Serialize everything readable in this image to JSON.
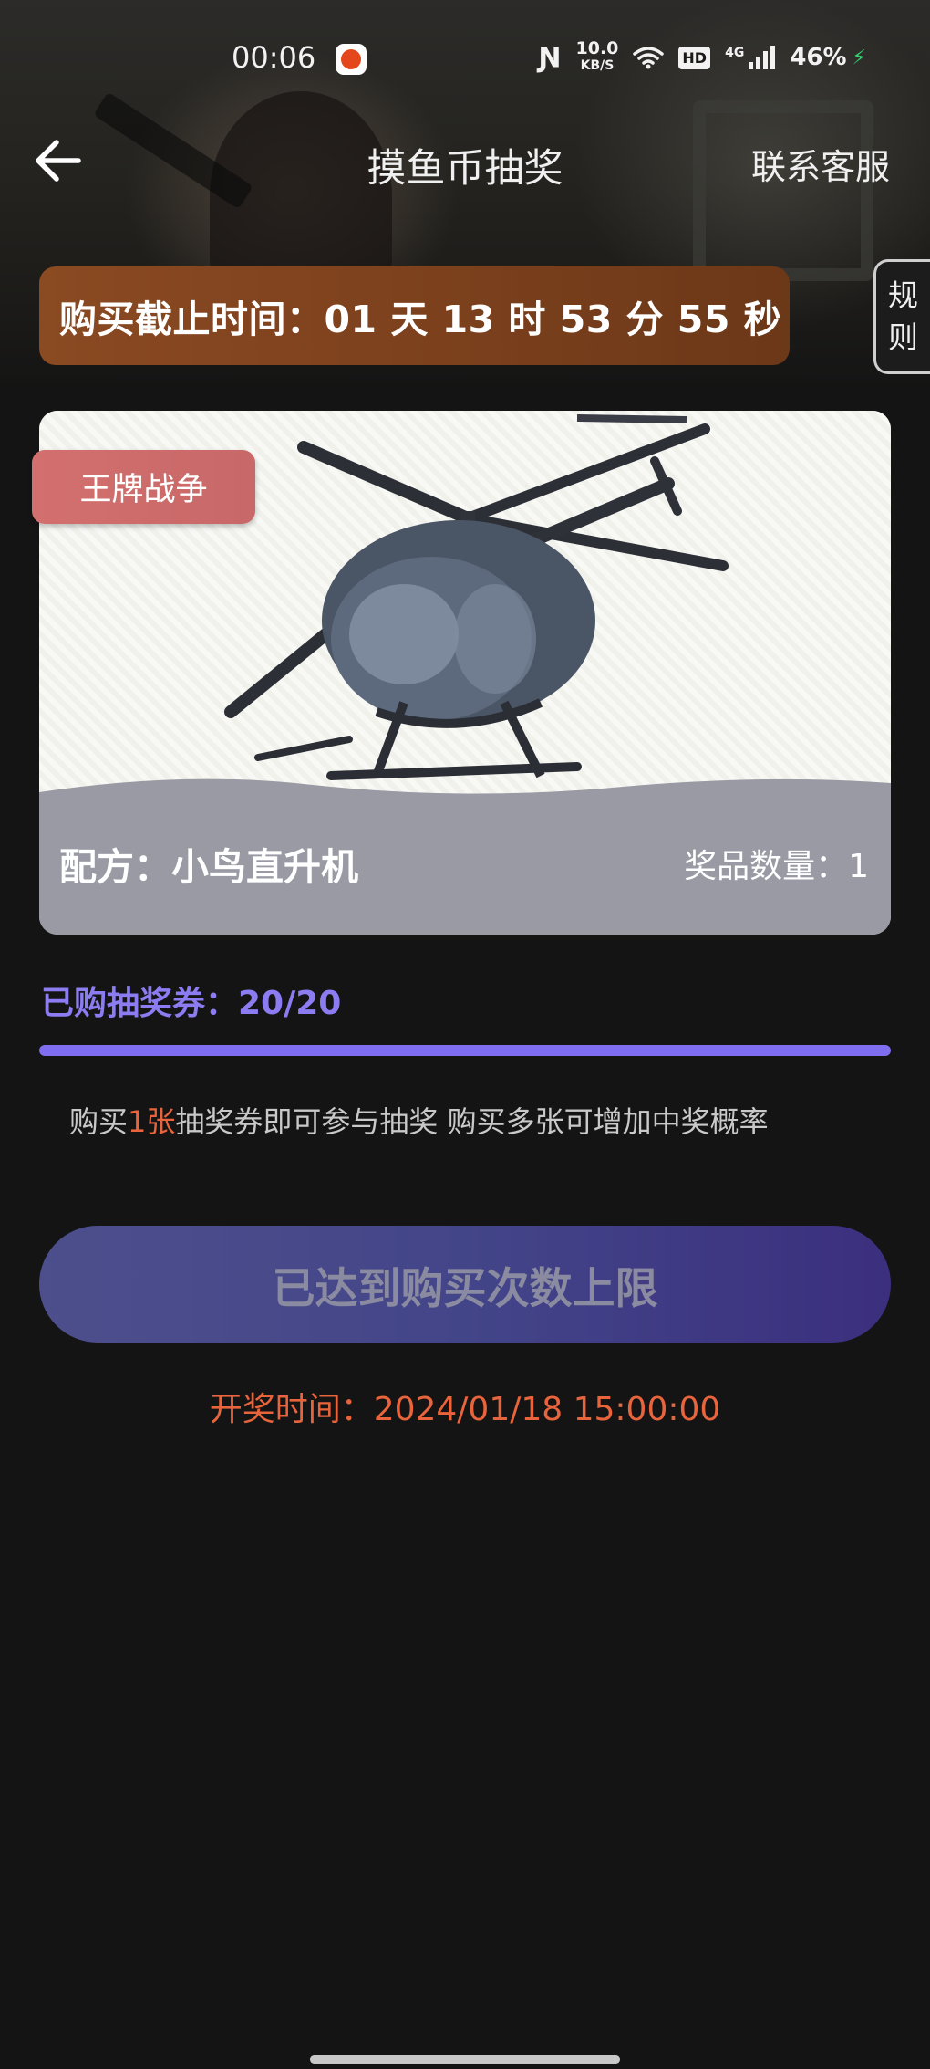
{
  "status_bar": {
    "time": "00:06",
    "net_speed_value": "10.0",
    "net_speed_unit": "KB/S",
    "hd_label": "HD",
    "network_type": "4G",
    "battery": "46%"
  },
  "nav": {
    "title": "摸鱼币抽奖",
    "contact_label": "联系客服"
  },
  "rules_tab": {
    "line1": "规",
    "line2": "则"
  },
  "countdown": {
    "text": "购买截止时间：01 天 13 时 53 分 55 秒"
  },
  "prize": {
    "game_tag": "王牌战争",
    "name": "配方：小鸟直升机",
    "quantity": "奖品数量：1"
  },
  "tickets": {
    "label": "已购抽奖券：20/20",
    "purchased": 20,
    "total": 20,
    "progress_fraction": 1.0
  },
  "hint": {
    "prefix": "购买",
    "highlight": "1张",
    "suffix": "抽奖券即可参与抽奖 购买多张可增加中奖概率"
  },
  "action_button": {
    "label": "已达到购买次数上限"
  },
  "draw_time": "开奖时间：2024/01/18 15:00:00",
  "colors": {
    "accent_purple": "#7f6ff0",
    "highlight_orange": "#e8643c",
    "countdown_brown": "#7a3f1c",
    "tag_red": "#d36f6f",
    "card_footer_gray": "#9a9aa4"
  },
  "icons": {
    "back": "arrow-left-icon",
    "nfc": "nfc-icon",
    "wifi": "wifi-icon",
    "signal": "signal-icon",
    "charging": "charging-icon"
  }
}
